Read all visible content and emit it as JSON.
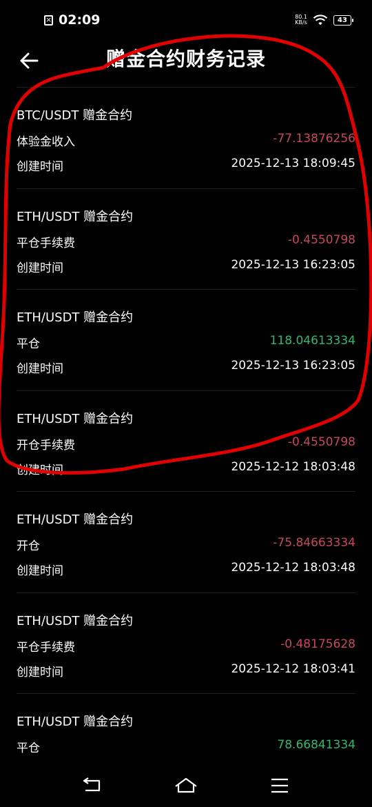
{
  "status": {
    "time": "02:09",
    "net_speed_value": "80.1",
    "net_speed_unit": "KB/s",
    "battery": "43"
  },
  "header": {
    "title": "赠金合约财务记录"
  },
  "records": [
    {
      "title": "BTC/USDT 赠金合约",
      "type": "体验金收入",
      "amount": "-77.13876256",
      "sign": "neg",
      "time_label": "创建时间",
      "time": "2025-12-13 18:09:45"
    },
    {
      "title": "ETH/USDT 赠金合约",
      "type": "平仓手续费",
      "amount": "-0.4550798",
      "sign": "neg",
      "time_label": "创建时间",
      "time": "2025-12-13 16:23:05"
    },
    {
      "title": "ETH/USDT 赠金合约",
      "type": "平仓",
      "amount": "118.04613334",
      "sign": "pos",
      "time_label": "创建时间",
      "time": "2025-12-13 16:23:05"
    },
    {
      "title": "ETH/USDT 赠金合约",
      "type": "开仓手续费",
      "amount": "-0.4550798",
      "sign": "neg",
      "time_label": "创建时间",
      "time": "2025-12-12 18:03:48"
    },
    {
      "title": "ETH/USDT 赠金合约",
      "type": "开仓",
      "amount": "-75.84663334",
      "sign": "neg",
      "time_label": "创建时间",
      "time": "2025-12-12 18:03:48"
    },
    {
      "title": "ETH/USDT 赠金合约",
      "type": "平仓手续费",
      "amount": "-0.48175628",
      "sign": "neg",
      "time_label": "创建时间",
      "time": "2025-12-12 18:03:41"
    },
    {
      "title": "ETH/USDT 赠金合约",
      "type": "平仓",
      "amount": "78.66841334",
      "sign": "pos",
      "time_label": "",
      "time": ""
    }
  ],
  "colors": {
    "negative": "#c8475a",
    "positive": "#2cba73",
    "annotation": "#e00000",
    "background": "#000000"
  },
  "icons": {
    "back": "arrow-left-icon",
    "nav_back": "return-icon",
    "nav_home": "home-icon",
    "nav_menu": "menu-icon"
  }
}
